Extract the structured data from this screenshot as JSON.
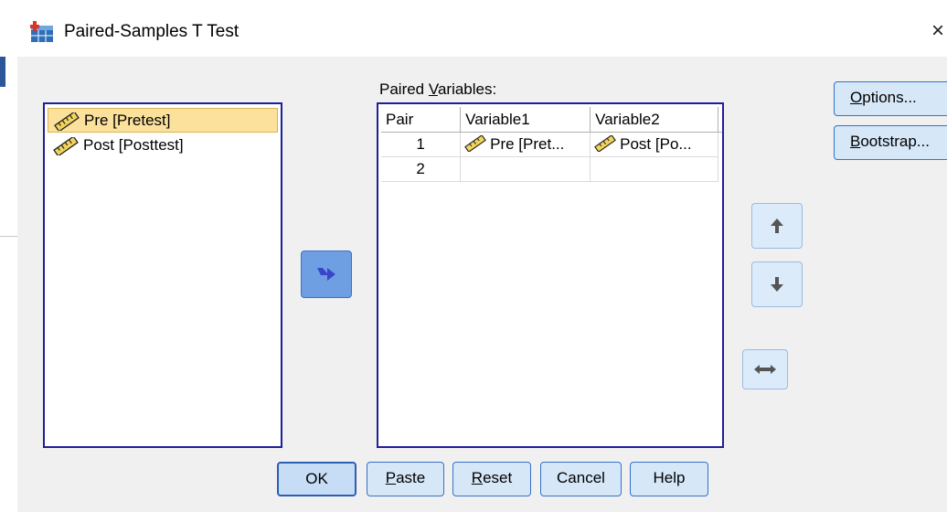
{
  "dialog": {
    "title": "Paired-Samples T Test",
    "close_glyph": "×"
  },
  "source_list": {
    "items": [
      {
        "label": "Pre [Pretest]",
        "icon": "scale-ruler-icon",
        "selected": true
      },
      {
        "label": "Post [Posttest]",
        "icon": "scale-ruler-icon",
        "selected": false
      }
    ]
  },
  "paired_variables": {
    "label_before": "Paired ",
    "label_mnemonic": "V",
    "label_after": "ariables:",
    "columns": [
      "Pair",
      "Variable1",
      "Variable2"
    ],
    "rows": [
      {
        "pair": "1",
        "variable1": "Pre [Pret...",
        "variable2": "Post [Po..."
      },
      {
        "pair": "2",
        "variable1": "",
        "variable2": ""
      }
    ]
  },
  "side_buttons": [
    {
      "mnemonic": "O",
      "rest": "ptions..."
    },
    {
      "mnemonic": "B",
      "rest": "ootstrap..."
    }
  ],
  "footer_buttons": {
    "ok": "OK",
    "paste_mnemonic": "P",
    "paste_rest": "aste",
    "reset_mnemonic": "R",
    "reset_rest": "eset",
    "cancel": "Cancel",
    "help": "Help"
  },
  "icons": {
    "move_right": "arrow-right-icon",
    "move_up": "arrow-up-icon",
    "move_down": "arrow-down-icon",
    "swap": "swap-horizontal-icon"
  },
  "colors": {
    "selection": "#fbe19c",
    "list_border": "#1f1f9a",
    "button_fill": "#d6e7f8",
    "button_border": "#3472c9",
    "active_arrow": "#6f9fe3"
  }
}
